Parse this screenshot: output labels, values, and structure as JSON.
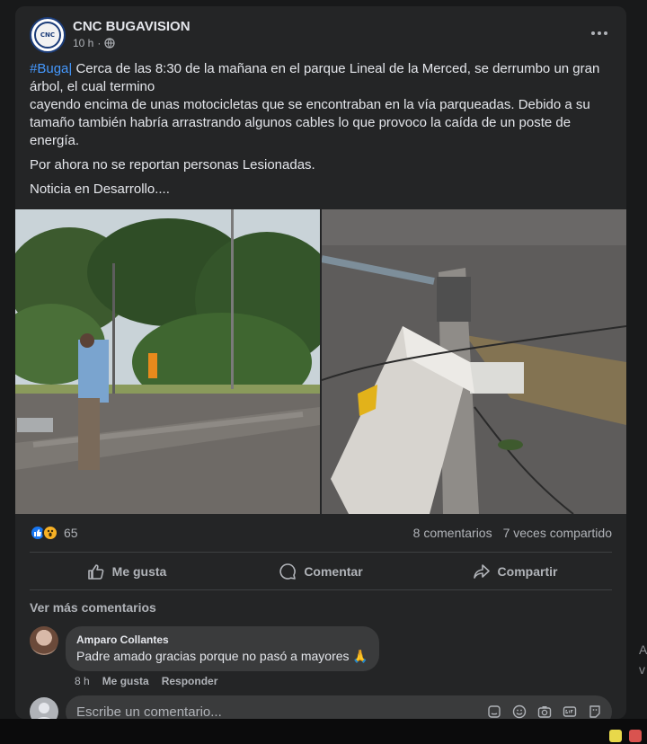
{
  "post": {
    "page_name": "CNC BUGAVISION",
    "logo_text": "CNC",
    "time": "10 h",
    "dot": "·",
    "hashtag": "#Buga|",
    "line1": " Cerca de las 8:30 de la mañana en el parque Lineal de la Merced, se derrumbo un gran árbol, el cual termino",
    "line2": "cayendo encima de unas motocicletas que se encontraban en la vía parqueadas. Debido a su tamaño también habría arrastrando algunos cables lo que provoco la caída de un poste de energía.",
    "para2": "Por ahora no se reportan personas Lesionadas.",
    "para3": "Noticia en Desarrollo...."
  },
  "stats": {
    "reaction_count": "65",
    "comments": "8 comentarios",
    "shares": "7 veces compartido"
  },
  "actions": {
    "like": "Me gusta",
    "comment": "Comentar",
    "share": "Compartir"
  },
  "comments_section": {
    "more_label": "Ver más comentarios",
    "items": [
      {
        "author": "Amparo Collantes",
        "text": "Padre amado gracias porque no pasó a mayores 🙏",
        "time": "8 h",
        "like": "Me gusta",
        "reply": "Responder"
      }
    ],
    "write_placeholder": "Escribe un comentario..."
  },
  "side_hint": {
    "line1": "A",
    "line2": "v"
  },
  "colors": {
    "background": "#18191a",
    "card": "#242526",
    "hashtag": "#4599ff",
    "like_reaction": "#1877f2",
    "wow_reaction": "#f7b125"
  },
  "icons": [
    "more-icon",
    "globe-icon",
    "like-reaction-icon",
    "wow-reaction-icon",
    "thumbs-up-icon",
    "comment-icon",
    "share-icon",
    "sticker-icon",
    "emoji-icon",
    "camera-icon",
    "gif-icon",
    "avatar-sticker-icon"
  ]
}
